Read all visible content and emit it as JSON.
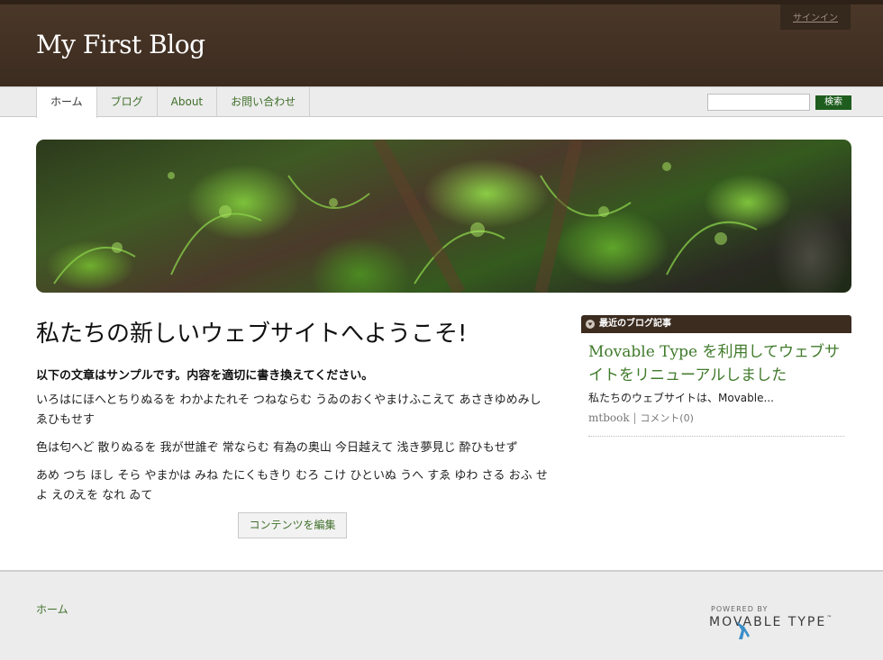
{
  "header": {
    "blog_title": "My First Blog",
    "signin_label": "サインイン"
  },
  "nav": {
    "tabs": [
      {
        "label": "ホーム",
        "active": true
      },
      {
        "label": "ブログ",
        "active": false
      },
      {
        "label": "About",
        "active": false
      },
      {
        "label": "お問い合わせ",
        "active": false
      }
    ],
    "search_placeholder": "",
    "search_button_label": "検索"
  },
  "main": {
    "title": "私たちの新しいウェブサイトへようこそ!",
    "lead": "以下の文章はサンプルです。内容を適切に書き換えてください。",
    "paragraphs": [
      "いろはにほへとちりぬるを わかよたれそ つねならむ うゐのおくやまけふこえて あさきゆめみし ゑひもせす",
      "色は匂へど 散りぬるを 我が世誰ぞ 常ならむ 有為の奥山 今日越えて 浅き夢見じ 酔ひもせず",
      "あめ つち ほし そら やまかは みね たにくもきり むろ こけ ひといぬ うへ すゑ ゆわ さる おふ せよ えのえを なれ ゐて"
    ],
    "edit_button_label": "コンテンツを編集"
  },
  "sidebar": {
    "widget_title": "最近のブログ記事",
    "recent": {
      "title": "Movable Type を利用してウェブサイトをリニューアルしました",
      "excerpt": "私たちのウェブサイトは、Movable...",
      "author": "mtbook",
      "separator": "|",
      "comments": "コメント(0)"
    }
  },
  "footer": {
    "home_link": "ホーム",
    "powered_by": "POWERED BY",
    "logo_text": "MOVABLE TYPE",
    "logo_tm": "™"
  },
  "colors": {
    "header_bg": "#3c2c20",
    "link_green": "#3f6f2a",
    "search_button": "#1e5d1e"
  }
}
